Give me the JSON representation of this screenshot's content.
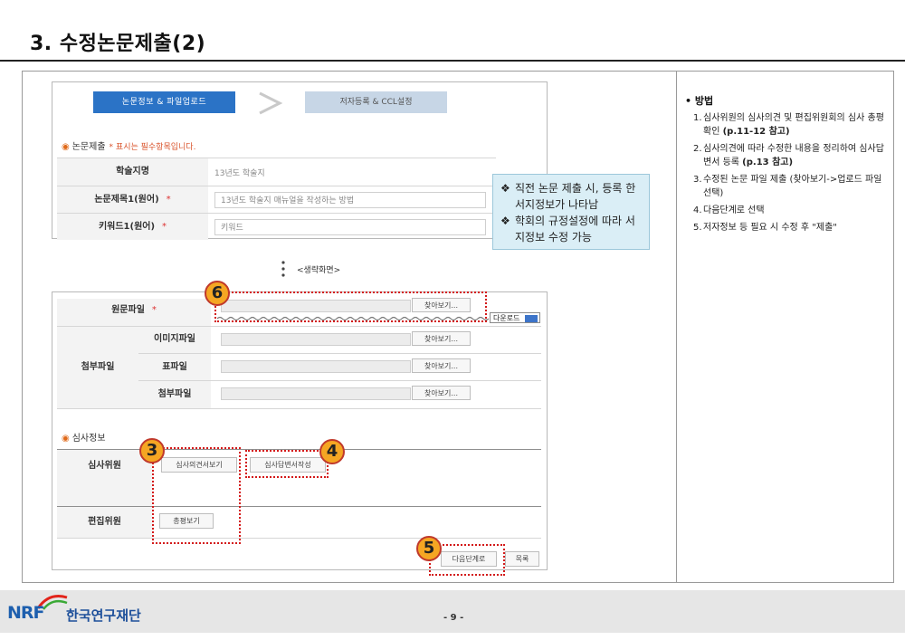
{
  "slide": {
    "title": "3. 수정논문제출(2)",
    "page_number": "- 9 -"
  },
  "steps": {
    "active": "논문정보 & 파일업로드",
    "inactive": "저자등록 & CCL설정"
  },
  "paper_section": {
    "heading": "논문제출",
    "required_note": "* 표시는 필수항목입니다.",
    "rows": [
      {
        "label": "학술지명",
        "required": "",
        "value": "13년도 학술지"
      },
      {
        "label": "논문제목1(원어)",
        "required": "*",
        "value": "13년도 학술지 매뉴얼을 작성하는 방법"
      },
      {
        "label": "키워드1(원어)",
        "required": "*",
        "value": "키워드"
      }
    ]
  },
  "note_box": {
    "items": [
      {
        "bullet": "❖",
        "text": "직전 논문 제출 시, 등록 한 서지정보가 나타남"
      },
      {
        "bullet": "❖",
        "text": "학회의 규정설정에 따라 서지정보 수정 가능"
      }
    ]
  },
  "omitted_label": "<생략화면>",
  "file_section": {
    "original_label": "원문파일",
    "required": "*",
    "browse_label": "찾아보기...",
    "download_label": "다운로드",
    "attach_group_label": "첨부파일",
    "attach_rows": [
      {
        "label": "이미지파일",
        "browse": "찾아보기..."
      },
      {
        "label": "표파일",
        "browse": "찾아보기..."
      },
      {
        "label": "첨부파일",
        "browse": "찾아보기..."
      }
    ]
  },
  "review_section": {
    "heading": "심사정보",
    "reviewer_label": "심사위원",
    "view_opinion_button": "심사의견서보기",
    "write_response_button": "심사답변서작성",
    "editor_label": "편집위원",
    "view_summary_button": "총평보기"
  },
  "nav_buttons": {
    "next": "다음단계로",
    "list": "목록"
  },
  "callouts": [
    "3",
    "4",
    "5",
    "6"
  ],
  "method": {
    "heading": "• 방법",
    "items": [
      {
        "n": "1.",
        "text": "심사위원의 심사의견 및 편집위원회의 심사 총평 확인 ",
        "bold": "(p.11-12 참고)"
      },
      {
        "n": "2.",
        "text": "심사의견에 따라 수정한 내용을 정리하여 심사답변서 등록 ",
        "bold": "(p.13 참고)"
      },
      {
        "n": "3.",
        "text": "수정된 논문 파일 제출 (찾아보기->업로드 파일 선택)",
        "bold": ""
      },
      {
        "n": "4.",
        "text": "다음단계로 선택",
        "bold": ""
      },
      {
        "n": "5.",
        "text": "저자정보 등 필요 시 수정 후 \"제출\"",
        "bold": ""
      }
    ]
  },
  "footer": {
    "logo_text": "NRF",
    "org_name": "한국연구재단"
  },
  "colors": {
    "accent_blue": "#2b73c6",
    "callout_orange": "#f5a623",
    "highlight_red": "#d31919",
    "note_bg": "#daeef6"
  }
}
